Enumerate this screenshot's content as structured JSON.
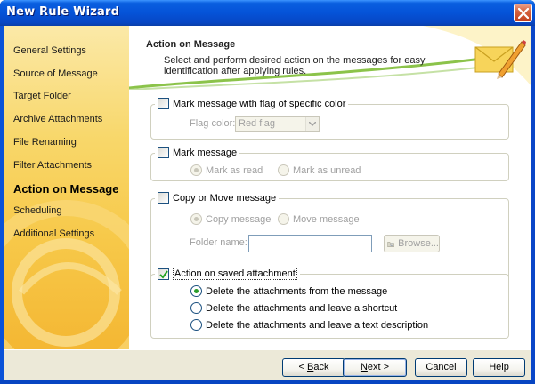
{
  "window": {
    "title": "New Rule Wizard"
  },
  "sidebar": {
    "items": [
      {
        "label": "General Settings"
      },
      {
        "label": "Source of Message"
      },
      {
        "label": "Target Folder"
      },
      {
        "label": "Archive Attachments"
      },
      {
        "label": "File Renaming"
      },
      {
        "label": "Filter Attachments"
      },
      {
        "label": "Action on Message",
        "active": true
      },
      {
        "label": "Scheduling"
      },
      {
        "label": "Additional Settings"
      }
    ]
  },
  "header": {
    "title": "Action on Message",
    "description": "Select and perform desired action on the messages for easy identification after applying rules."
  },
  "groups": {
    "flag": {
      "label": "Mark message with flag of specific color",
      "checked": false,
      "flag_color_label": "Flag color:",
      "flag_color_value": "Red flag"
    },
    "mark": {
      "label": "Mark message",
      "checked": false,
      "options": [
        "Mark as read",
        "Mark as unread"
      ],
      "selected": 0
    },
    "copy_move": {
      "label": "Copy or Move message",
      "checked": false,
      "options": [
        "Copy message",
        "Move message"
      ],
      "selected": 0,
      "folder_label": "Folder name:",
      "folder_value": "",
      "browse_label": "Browse..."
    },
    "attachment": {
      "label": "Action on saved attachment",
      "checked": true,
      "options": [
        "Delete the attachments from the message",
        "Delete the attachments and leave a shortcut",
        "Delete the attachments and leave a text description"
      ],
      "selected": 0
    }
  },
  "footer": {
    "back_pre": "< ",
    "back_key": "B",
    "back_post": "ack",
    "next_key": "N",
    "next_post": "ext >",
    "cancel": "Cancel",
    "help": "Help"
  },
  "colors": {
    "titlebar": "#0553d8",
    "sidebar": "#f7c94a",
    "accent_green": "#8bc34a"
  }
}
